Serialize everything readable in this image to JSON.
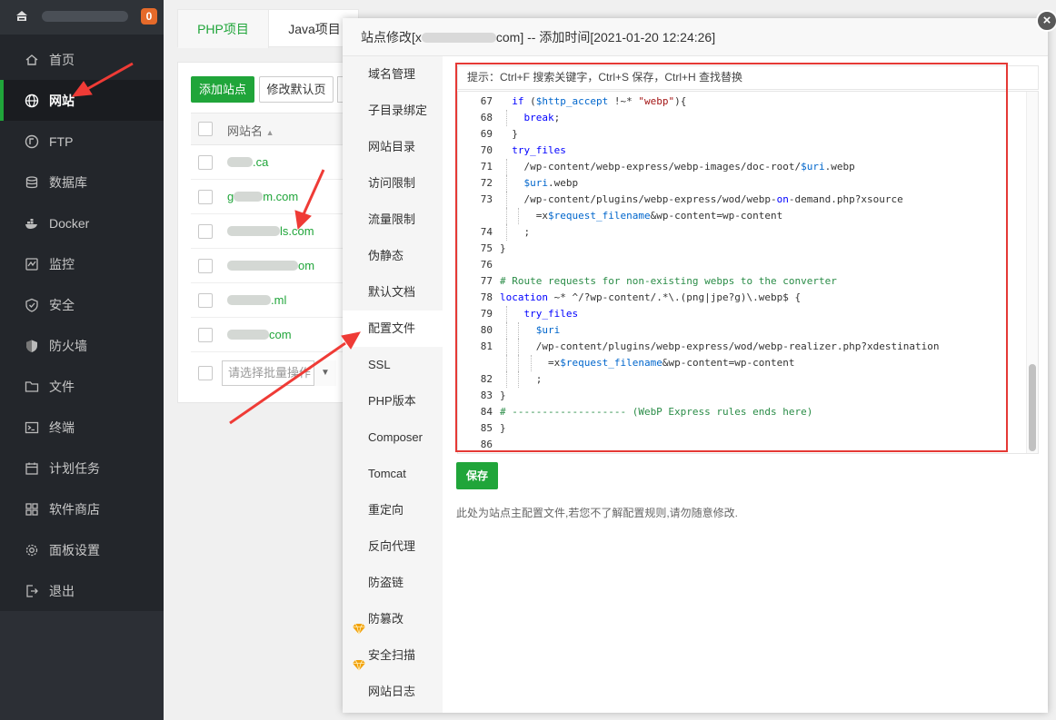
{
  "sidebar": {
    "badge": "0",
    "items": [
      {
        "label": "首页",
        "icon": "home-icon"
      },
      {
        "label": "网站",
        "icon": "globe-icon",
        "active": true
      },
      {
        "label": "FTP",
        "icon": "ftp-icon"
      },
      {
        "label": "数据库",
        "icon": "database-icon"
      },
      {
        "label": "Docker",
        "icon": "docker-icon"
      },
      {
        "label": "监控",
        "icon": "monitor-icon"
      },
      {
        "label": "安全",
        "icon": "shield-icon"
      },
      {
        "label": "防火墙",
        "icon": "firewall-icon"
      },
      {
        "label": "文件",
        "icon": "folder-icon"
      },
      {
        "label": "终端",
        "icon": "terminal-icon"
      },
      {
        "label": "计划任务",
        "icon": "calendar-icon"
      },
      {
        "label": "软件商店",
        "icon": "grid-icon"
      },
      {
        "label": "面板设置",
        "icon": "gear-icon"
      },
      {
        "label": "退出",
        "icon": "logout-icon"
      }
    ]
  },
  "project_tabs": {
    "php": "PHP项目",
    "java": "Java项目"
  },
  "toolbar": {
    "add_site": "添加站点",
    "modify_default": "修改默认页"
  },
  "site_table": {
    "column_site_name": "网站名",
    "sort_icon": "sort-up-icon",
    "rows": [
      ".ca",
      "g",
      "ls.com",
      "om",
      ".ml",
      "com"
    ],
    "rows_suffix": [
      "",
      "m.com",
      "",
      "",
      "",
      ""
    ],
    "batch_placeholder": "请选择批量操作"
  },
  "modal": {
    "title_prefix": "站点修改[x",
    "title_suffix": "com] -- 添加时间[2021-01-20 12:24:26]",
    "close_label": "×",
    "nav": [
      {
        "label": "域名管理"
      },
      {
        "label": "子目录绑定"
      },
      {
        "label": "网站目录"
      },
      {
        "label": "访问限制"
      },
      {
        "label": "流量限制"
      },
      {
        "label": "伪静态"
      },
      {
        "label": "默认文档"
      },
      {
        "label": "配置文件",
        "active": true
      },
      {
        "label": "SSL"
      },
      {
        "label": "PHP版本"
      },
      {
        "label": "Composer"
      },
      {
        "label": "Tomcat"
      },
      {
        "label": "重定向"
      },
      {
        "label": "反向代理"
      },
      {
        "label": "防盗链"
      },
      {
        "label": "防篡改",
        "gem": true
      },
      {
        "label": "安全扫描",
        "gem": true
      },
      {
        "label": "网站日志"
      }
    ],
    "tip": "提示：Ctrl+F 搜索关键字，Ctrl+S 保存，Ctrl+H 查找替换",
    "code_lines": [
      {
        "n": "67",
        "t": "  if ($http_accept !~* \"webp\"){"
      },
      {
        "n": "68",
        "t": "    break;"
      },
      {
        "n": "69",
        "t": "  }"
      },
      {
        "n": "70",
        "t": "  try_files"
      },
      {
        "n": "71",
        "t": "    /wp-content/webp-express/webp-images/doc-root/$uri.webp"
      },
      {
        "n": "72",
        "t": "    $uri.webp"
      },
      {
        "n": "73",
        "t": "    /wp-content/plugins/webp-express/wod/webp-on-demand.php?xsource"
      },
      {
        "n": "",
        "t": "      =x$request_filename&wp-content=wp-content"
      },
      {
        "n": "74",
        "t": "    ;"
      },
      {
        "n": "75",
        "t": "}"
      },
      {
        "n": "76",
        "t": ""
      },
      {
        "n": "77",
        "t": "# Route requests for non-existing webps to the converter"
      },
      {
        "n": "78",
        "t": "location ~* ^/?wp-content/.*\\.(png|jpe?g)\\.webp$ {"
      },
      {
        "n": "79",
        "t": "    try_files"
      },
      {
        "n": "80",
        "t": "      $uri"
      },
      {
        "n": "81",
        "t": "      /wp-content/plugins/webp-express/wod/webp-realizer.php?xdestination"
      },
      {
        "n": "",
        "t": "        =x$request_filename&wp-content=wp-content"
      },
      {
        "n": "82",
        "t": "      ;"
      },
      {
        "n": "83",
        "t": "}"
      },
      {
        "n": "84",
        "t": "# ------------------- (WebP Express rules ends here)"
      },
      {
        "n": "85",
        "t": "}"
      },
      {
        "n": "86",
        "t": ""
      }
    ],
    "save_label": "保存",
    "save_note": "此处为站点主配置文件,若您不了解配置规则,请勿随意修改."
  },
  "colors": {
    "accent": "#20a53a",
    "annotation": "#e53935",
    "sidebar_bg": "#23262b"
  }
}
